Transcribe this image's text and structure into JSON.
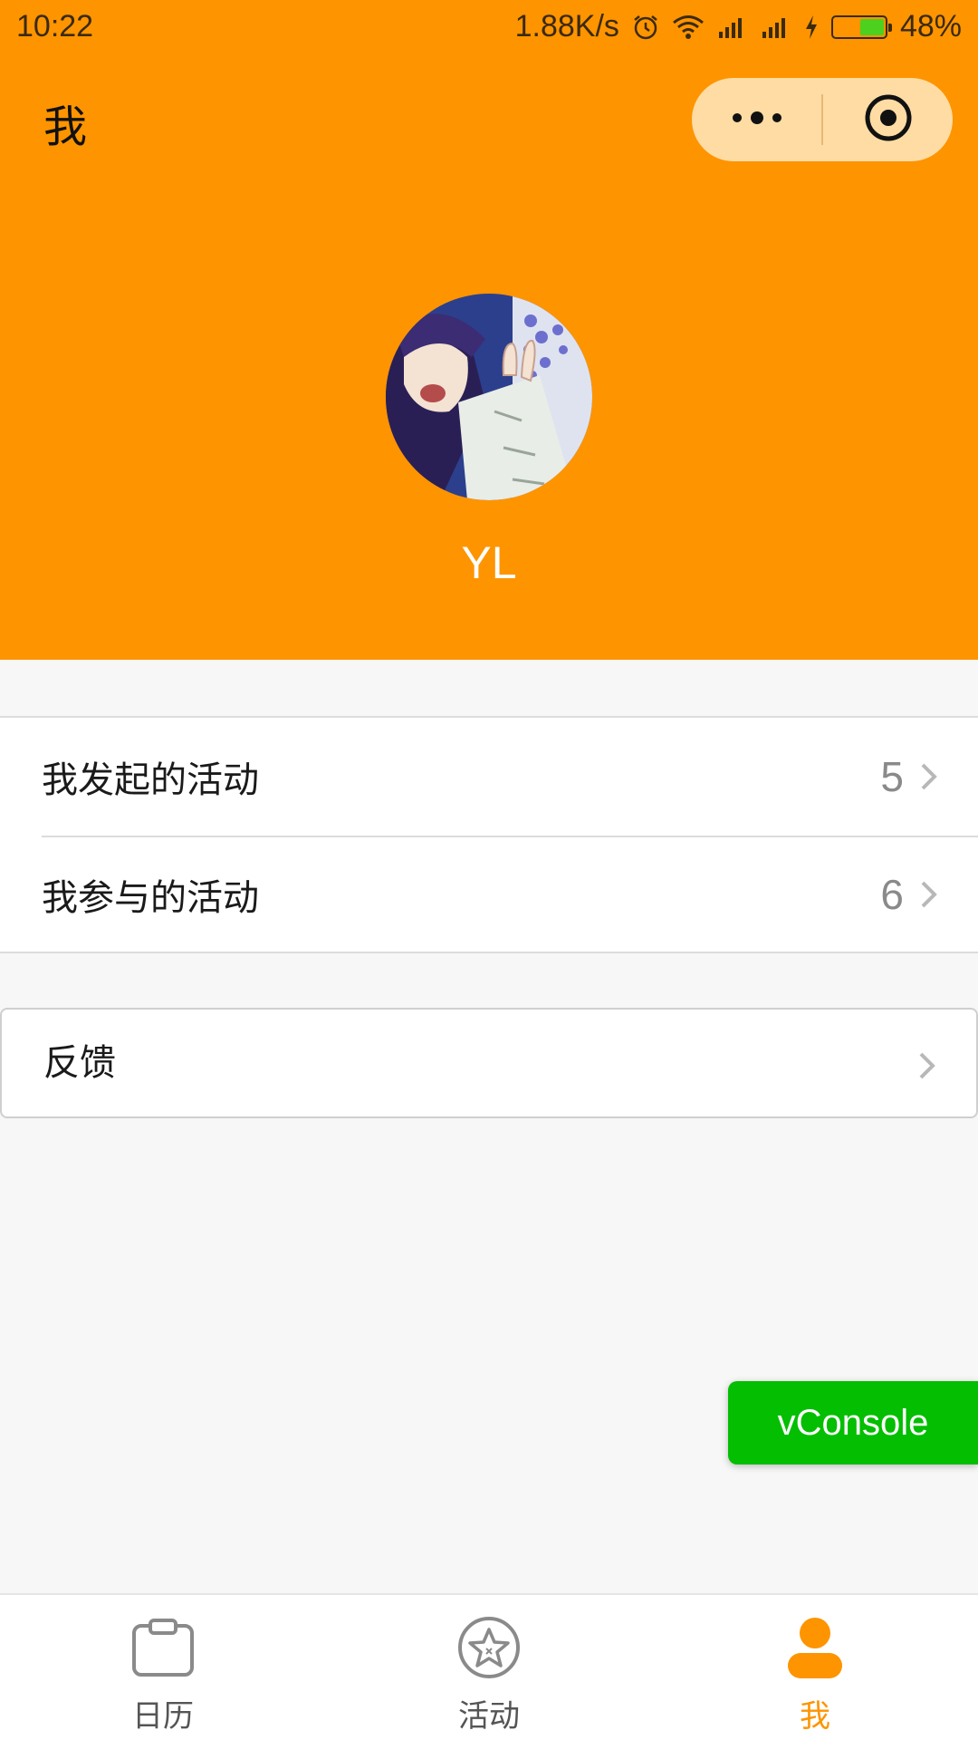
{
  "status_bar": {
    "time": "10:22",
    "net_speed": "1.88K/s",
    "battery_percent": "48%",
    "battery_level": 0.48
  },
  "nav": {
    "title": "我",
    "more_icon": "more-dots-icon",
    "close_icon": "target-circle-icon"
  },
  "profile": {
    "username": "YL"
  },
  "menu": {
    "items": [
      {
        "label": "我发起的活动",
        "count": "5"
      },
      {
        "label": "我参与的活动",
        "count": "6"
      }
    ],
    "feedback_label": "反馈"
  },
  "vconsole": {
    "label": "vConsole"
  },
  "tabbar": {
    "tabs": [
      {
        "label": "日历",
        "icon": "calendar-icon"
      },
      {
        "label": "活动",
        "icon": "star-badge-icon"
      },
      {
        "label": "我",
        "icon": "user-icon",
        "active": true
      }
    ]
  },
  "colors": {
    "brand_orange": "#fe9400",
    "capsule_bg": "#ffdca3",
    "vconsole_green": "#04be02",
    "battery_green": "#4cd11f"
  }
}
